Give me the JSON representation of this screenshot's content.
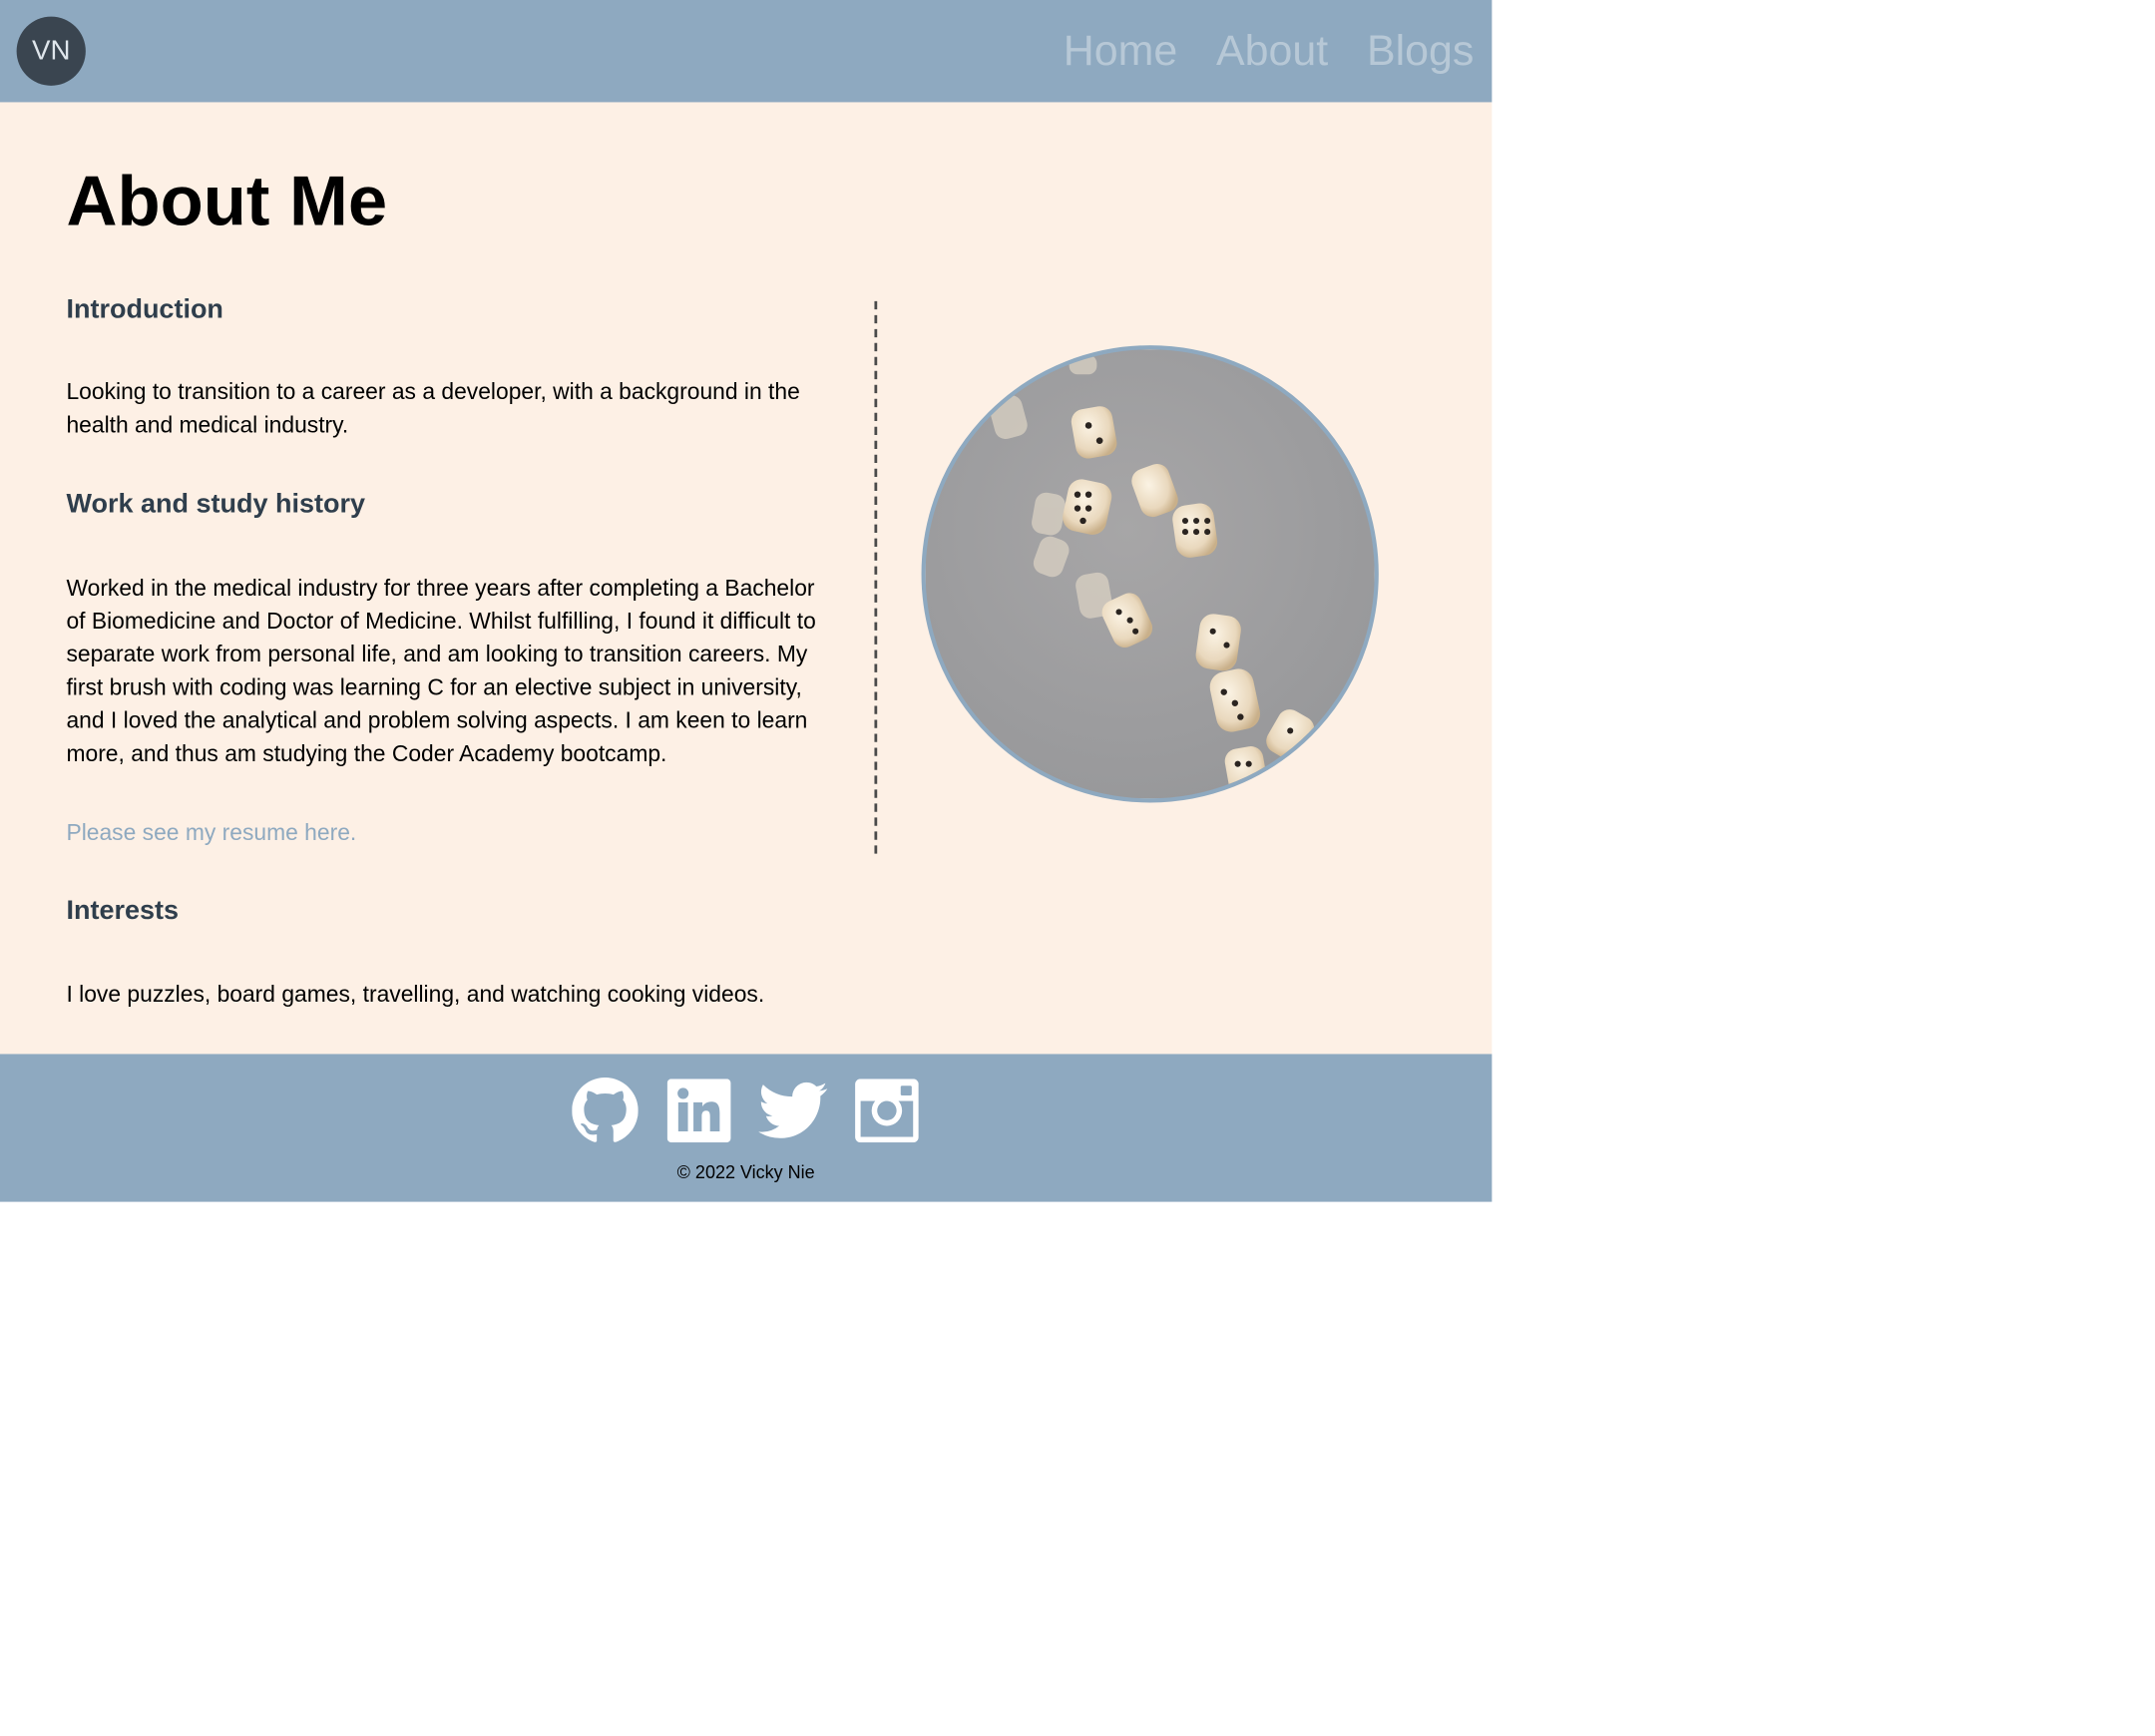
{
  "header": {
    "logo_text": "VN",
    "nav": [
      {
        "label": "Home"
      },
      {
        "label": "About"
      },
      {
        "label": "Blogs"
      }
    ]
  },
  "main": {
    "title": "About Me",
    "sections": {
      "introduction": {
        "heading": "Introduction",
        "body": "Looking to transition to a career as a developer, with a background in the health and medical industry."
      },
      "history": {
        "heading": "Work and study history",
        "body": "Worked in the medical industry for three years after completing a Bachelor of Biomedicine and Doctor of Medicine. Whilst fulfilling, I found it difficult to separate work from personal life, and am looking to transition careers. My first brush with coding was learning C for an elective subject in university, and I loved the analytical and problem solving aspects. I am keen to learn more, and thus am studying the Coder Academy bootcamp.",
        "resume_link": "Please see my resume here."
      },
      "interests": {
        "heading": "Interests",
        "body": "I love puzzles, board games, travelling, and watching cooking videos."
      }
    },
    "photo": {
      "subject": "falling dice",
      "icon": "dice-photo"
    }
  },
  "footer": {
    "socials": [
      {
        "name": "github-icon"
      },
      {
        "name": "linkedin-icon"
      },
      {
        "name": "twitter-icon"
      },
      {
        "name": "instagram-icon"
      }
    ],
    "copyright": "© 2022 Vicky Nie"
  },
  "colors": {
    "header_bg": "#8ea9c0",
    "main_bg": "#fdf0e5",
    "nav_text": "#b7c8d6",
    "logo_bg": "#3a4550",
    "heading_text": "#2f3e4c"
  }
}
